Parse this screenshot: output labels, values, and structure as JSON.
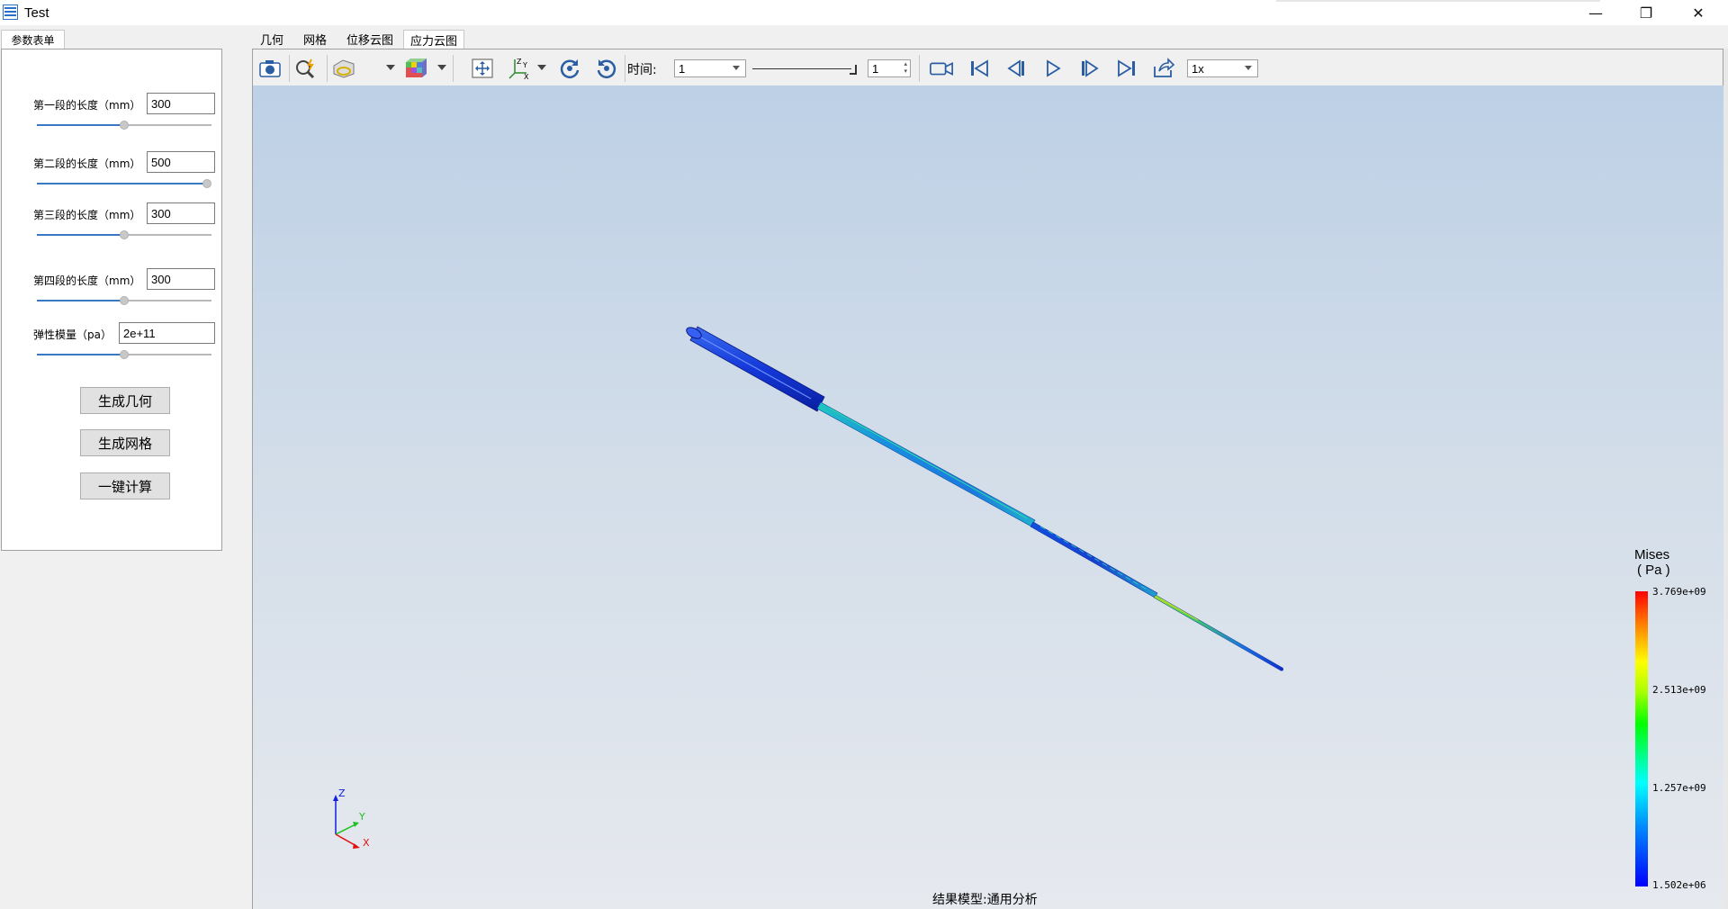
{
  "window": {
    "title": "Test",
    "minimize": "—",
    "maximize": "❐",
    "close": "✕"
  },
  "left_tab": "参数表单",
  "params": [
    {
      "label": "第一段的长度（mm）",
      "value": "300",
      "level": 0.5
    },
    {
      "label": "第二段的长度（mm）",
      "value": "500",
      "level": 1.0
    },
    {
      "label": "第三段的长度（mm）",
      "value": "300",
      "level": 0.5
    },
    {
      "label": "第四段的长度（mm）",
      "value": "300",
      "level": 0.5
    },
    {
      "label": "弹性模量（pa）",
      "value": "2e+11",
      "level": 0.5
    }
  ],
  "buttons": {
    "gen_geometry": "生成几何",
    "gen_mesh": "生成网格",
    "compute": "一键计算"
  },
  "top_tabs": [
    "几何",
    "网格",
    "位移云图",
    "应力云图"
  ],
  "active_tab": "应力云图",
  "toolbar": {
    "time_label": "时间:",
    "time_value": "1",
    "frame_value": "1",
    "speed_value": "1x"
  },
  "viewport": {
    "caption": "结果模型:通用分析",
    "legend_title_1": "Mises",
    "legend_title_2": "( Pa )",
    "legend_values": [
      "3.769e+09",
      "2.513e+09",
      "1.257e+09",
      "1.502e+06"
    ],
    "axis_labels": {
      "x": "X",
      "y": "Y",
      "z": "Z"
    }
  },
  "colors": {
    "accent": "#3b78c4",
    "x_axis": "#e01010",
    "y_axis": "#20c020",
    "z_axis": "#1020e0"
  }
}
